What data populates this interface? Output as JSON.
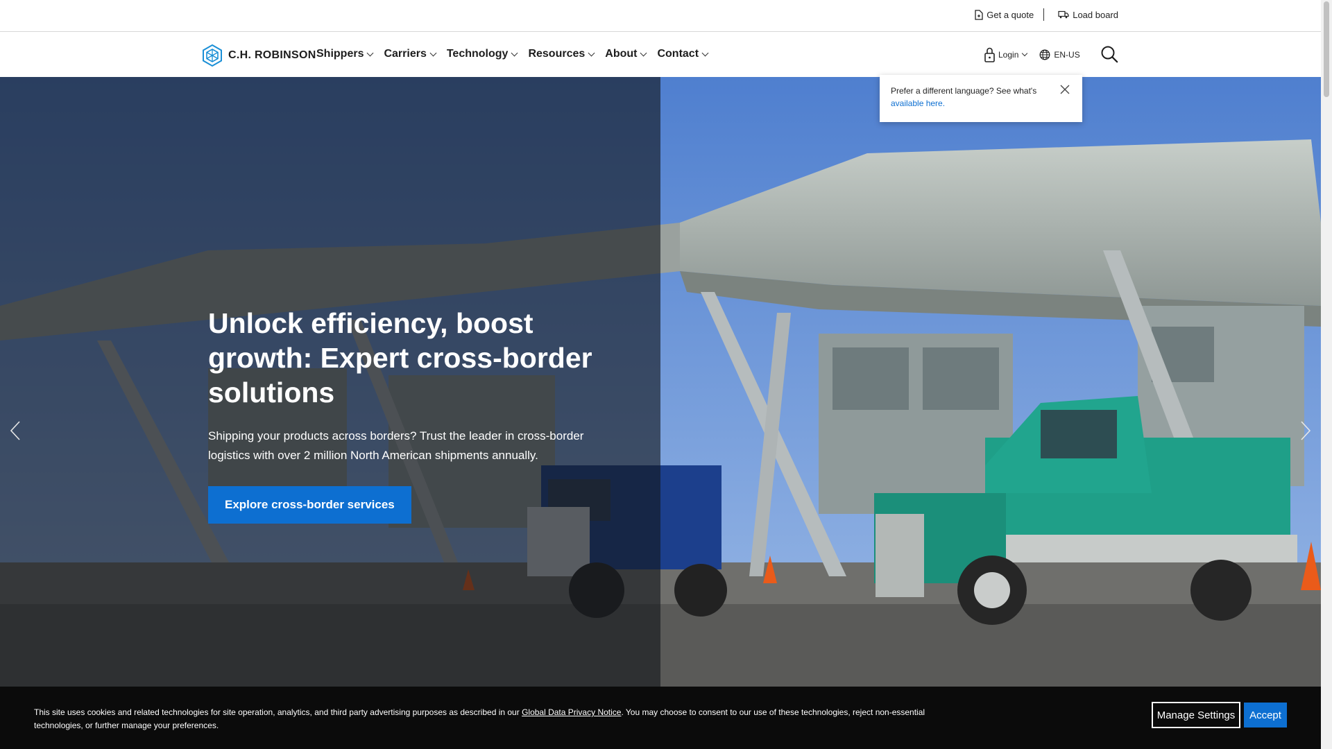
{
  "utility": {
    "quote_label": "Get a quote",
    "loadboard_label": "Load board"
  },
  "brand": {
    "name": "C.H. ROBINSON",
    "accent_color": "#0d6fd1"
  },
  "nav": {
    "items": [
      {
        "label": "Shippers"
      },
      {
        "label": "Carriers"
      },
      {
        "label": "Technology"
      },
      {
        "label": "Resources"
      },
      {
        "label": "About"
      },
      {
        "label": "Contact"
      }
    ],
    "login_label": "Login",
    "language_label": "EN-US"
  },
  "language_popover": {
    "text": "Prefer a different language? See what's",
    "link_text": "available here."
  },
  "hero": {
    "title": "Unlock efficiency, boost growth: Expert cross-border solutions",
    "text": "Shipping your products across borders? Trust the leader in cross-border logistics with over 2 million North American shipments annually.",
    "cta_label": "Explore cross-border services"
  },
  "cookie": {
    "text_before": "This site uses cookies and related technologies for site operation, analytics, and third party advertising purposes as described in our ",
    "link_text": "Global Data Privacy Notice",
    "text_after": ". You may choose to consent to our use of these technologies, reject non-essential technologies, or further manage your preferences.",
    "manage_label": "Manage Settings",
    "accept_label": "Accept"
  },
  "icons": [
    "document-icon",
    "truck-icon",
    "logo-icon",
    "lock-icon",
    "globe-icon",
    "search-icon",
    "close-icon",
    "chevron-left-icon",
    "chevron-right-icon"
  ]
}
